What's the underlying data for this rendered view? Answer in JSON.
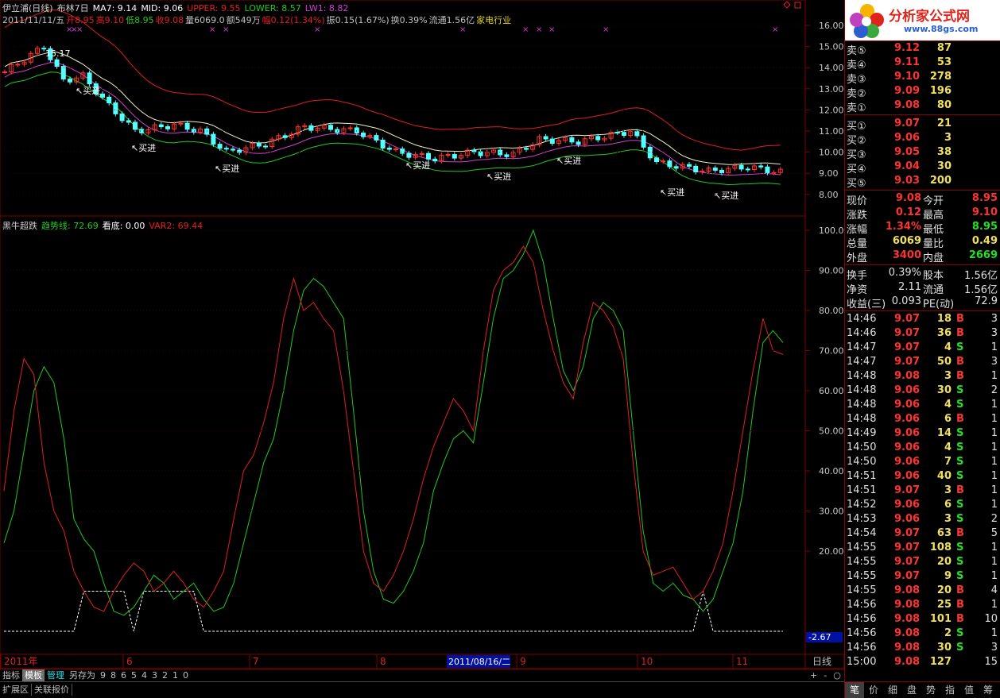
{
  "header": {
    "name": "伊立浦(日线)",
    "indicator": "布林7日",
    "ma7": "MA7: 9.14",
    "mid": "MID: 9.06",
    "upper": "UPPER: 9.55",
    "lower": "LOWER: 8.57",
    "lw1": "LW1: 8.82"
  },
  "quote_line": {
    "date": "2011/11/11/五",
    "open": "开8.95",
    "high": "高9.10",
    "low": "低8.95",
    "close": "收9.08",
    "vol": "量6069.0",
    "amt": "额549万",
    "chg": "幅0.12(1.34%)",
    "amp": "振0.15(1.67%)",
    "turn": "换0.39%",
    "float": "流通1.56亿",
    "industry": "家电行业"
  },
  "ind_header": {
    "name": "黑牛超跌",
    "trend": "趋势线: 72.69",
    "bottom": "看底: 0.00",
    "var2": "VAR2: 69.44"
  },
  "chart_data": [
    {
      "type": "candlestick",
      "title": "伊立浦(日线) 布林7日",
      "ylim": [
        7.6,
        16.4
      ],
      "yticks": [
        "16.00",
        "15.00",
        "14.00",
        "13.00",
        "12.00",
        "11.00",
        "10.00",
        "9.00",
        "8.00"
      ],
      "high_label": "15.17",
      "signals": [
        "买进",
        "买进",
        "买进",
        "买进",
        "买进",
        "买进",
        "买进",
        "买进"
      ]
    },
    {
      "type": "line",
      "title": "黑牛超跌",
      "ylim": [
        -5,
        102
      ],
      "yticks": [
        "100.0",
        "90.00",
        "80.00",
        "70.00",
        "60.00",
        "50.00",
        "40.00",
        "30.00",
        "20.00"
      ],
      "cursor_value": "-2.67",
      "series": [
        {
          "name": "趋势线",
          "color": "#22c822",
          "values": [
            22,
            30,
            45,
            60,
            66,
            62,
            48,
            28,
            23,
            20,
            12,
            5,
            4,
            6,
            10,
            14,
            12,
            8,
            10,
            12,
            8,
            5,
            6,
            12,
            22,
            32,
            42,
            48,
            60,
            75,
            85,
            88,
            86,
            82,
            78,
            55,
            30,
            15,
            8,
            7,
            10,
            15,
            22,
            35,
            42,
            48,
            50,
            47,
            62,
            78,
            88,
            90,
            94,
            100,
            92,
            78,
            65,
            60,
            66,
            78,
            82,
            80,
            75,
            50,
            25,
            12,
            10,
            12,
            9,
            8,
            5,
            8,
            15,
            22,
            35,
            55,
            72,
            75,
            72
          ]
        },
        {
          "name": "VAR2",
          "color": "#e02020",
          "values": [
            35,
            55,
            68,
            64,
            42,
            30,
            25,
            15,
            10,
            6,
            5,
            10,
            14,
            17,
            15,
            10,
            12,
            15,
            12,
            8,
            6,
            10,
            15,
            28,
            40,
            44,
            52,
            62,
            78,
            88,
            80,
            82,
            78,
            75,
            60,
            40,
            20,
            12,
            10,
            14,
            20,
            28,
            38,
            46,
            52,
            58,
            55,
            50,
            70,
            85,
            90,
            92,
            96,
            92,
            80,
            70,
            62,
            58,
            72,
            82,
            80,
            76,
            68,
            42,
            20,
            14,
            15,
            16,
            12,
            8,
            10,
            15,
            22,
            35,
            50,
            65,
            78,
            70,
            69
          ]
        }
      ],
      "dashed": {
        "color": "#ffffff",
        "values": [
          0,
          0,
          0,
          0,
          0,
          0,
          0,
          0,
          10,
          10,
          10,
          10,
          10,
          0,
          10,
          10,
          10,
          10,
          10,
          10,
          0,
          0,
          0,
          0,
          0,
          0,
          0,
          0,
          0,
          0,
          0,
          0,
          0,
          0,
          0,
          0,
          0,
          0,
          0,
          0,
          0,
          0,
          0,
          0,
          0,
          0,
          0,
          0,
          0,
          0,
          0,
          0,
          0,
          0,
          0,
          0,
          0,
          0,
          0,
          0,
          0,
          0,
          0,
          0,
          0,
          0,
          0,
          0,
          0,
          0,
          10,
          0,
          0,
          0,
          0,
          0,
          0,
          0,
          0
        ]
      }
    }
  ],
  "xaxis": {
    "labels": [
      "2011年",
      "6",
      "7",
      "8",
      "9",
      "10",
      "11"
    ],
    "cursor_date": "2011/08/16/二",
    "period": "日线"
  },
  "bottom": {
    "tabs": [
      "指标",
      "模板",
      "管理",
      "另存为",
      "9",
      "8",
      "6",
      "5",
      "4",
      "3",
      "2",
      "1",
      "0"
    ],
    "tabs2": [
      "扩展区",
      "关联报价"
    ],
    "zoom": [
      "+",
      "-",
      "○"
    ]
  },
  "logo": {
    "title": "分析家公式网",
    "url": "www.88gs.com"
  },
  "orderbook": {
    "asks": [
      [
        "卖⑤",
        "9.12",
        "87"
      ],
      [
        "卖④",
        "9.11",
        "53"
      ],
      [
        "卖③",
        "9.10",
        "278"
      ],
      [
        "卖②",
        "9.09",
        "196"
      ],
      [
        "卖①",
        "9.08",
        "80"
      ]
    ],
    "bids": [
      [
        "买①",
        "9.07",
        "21"
      ],
      [
        "买②",
        "9.06",
        "3"
      ],
      [
        "买③",
        "9.05",
        "38"
      ],
      [
        "买④",
        "9.04",
        "30"
      ],
      [
        "买⑤",
        "9.03",
        "200"
      ]
    ]
  },
  "stats": [
    [
      "现价",
      "9.08",
      "今开",
      "8.95"
    ],
    [
      "涨跌",
      "0.12",
      "最高",
      "9.10"
    ],
    [
      "涨幅",
      "1.34%",
      "最低",
      "8.95"
    ],
    [
      "总量",
      "6069",
      "量比",
      "0.49"
    ],
    [
      "外盘",
      "3400",
      "内盘",
      "2669"
    ]
  ],
  "stats2": [
    [
      "换手",
      "0.39%",
      "股本",
      "1.56亿"
    ],
    [
      "净资",
      "2.11",
      "流通",
      "1.56亿"
    ],
    [
      "收益(三)",
      "0.093",
      "PE(动)",
      "72.9"
    ]
  ],
  "ticks": [
    [
      "14:46",
      "9.07",
      "18",
      "B",
      "3"
    ],
    [
      "14:46",
      "9.07",
      "36",
      "B",
      "3"
    ],
    [
      "14:47",
      "9.07",
      "4",
      "S",
      "1"
    ],
    [
      "14:47",
      "9.07",
      "50",
      "B",
      "3"
    ],
    [
      "14:48",
      "9.08",
      "3",
      "B",
      "1"
    ],
    [
      "14:48",
      "9.06",
      "30",
      "S",
      "2"
    ],
    [
      "14:48",
      "9.06",
      "4",
      "S",
      "1"
    ],
    [
      "14:48",
      "9.06",
      "6",
      "B",
      "1"
    ],
    [
      "14:49",
      "9.06",
      "14",
      "S",
      "1"
    ],
    [
      "14:50",
      "9.06",
      "4",
      "S",
      "1"
    ],
    [
      "14:50",
      "9.06",
      "7",
      "S",
      "1"
    ],
    [
      "14:51",
      "9.06",
      "40",
      "S",
      "1"
    ],
    [
      "14:51",
      "9.07",
      "3",
      "B",
      "1"
    ],
    [
      "14:52",
      "9.06",
      "6",
      "S",
      "1"
    ],
    [
      "14:53",
      "9.06",
      "3",
      "S",
      "2"
    ],
    [
      "14:54",
      "9.07",
      "63",
      "B",
      "5"
    ],
    [
      "14:55",
      "9.07",
      "108",
      "S",
      "1"
    ],
    [
      "14:55",
      "9.07",
      "20",
      "S",
      "1"
    ],
    [
      "14:55",
      "9.07",
      "9",
      "S",
      "1"
    ],
    [
      "14:55",
      "9.08",
      "20",
      "B",
      "4"
    ],
    [
      "14:56",
      "9.08",
      "25",
      "B",
      "1"
    ],
    [
      "14:56",
      "9.08",
      "101",
      "B",
      "10"
    ],
    [
      "14:56",
      "9.08",
      "2",
      "S",
      "1"
    ],
    [
      "14:56",
      "9.08",
      "30",
      "S",
      "3"
    ],
    [
      "15:00",
      "9.08",
      "127",
      "",
      "15"
    ]
  ],
  "side_tabs": [
    "笔",
    "价",
    "细",
    "盘",
    "势",
    "指",
    "值",
    "筹"
  ],
  "colors": {
    "up": "#ff3232",
    "down": "#54ffff",
    "grid": "#800000",
    "label": "#c8c8c8"
  }
}
